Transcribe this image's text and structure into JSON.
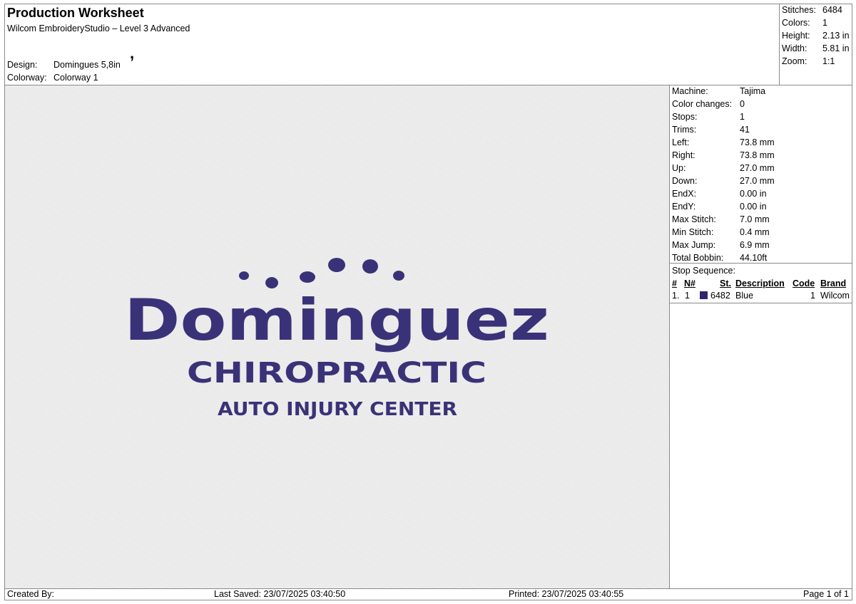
{
  "header": {
    "title": "Production Worksheet",
    "subtitle": "Wilcom EmbroideryStudio – Level 3 Advanced",
    "design_label": "Design:",
    "design_value": "Domingues 5,8in",
    "colorway_label": "Colorway:",
    "colorway_value": "Colorway 1",
    "mark": ","
  },
  "stats": [
    {
      "label": "Stitches:",
      "value": "6484"
    },
    {
      "label": "Colors:",
      "value": "1"
    },
    {
      "label": "Height:",
      "value": "2.13 in"
    },
    {
      "label": "Width:",
      "value": "5.81 in"
    },
    {
      "label": "Zoom:",
      "value": "1:1"
    }
  ],
  "machine_info": [
    {
      "label": "Machine:",
      "value": "Tajima"
    },
    {
      "label": "Color changes:",
      "value": "0"
    },
    {
      "label": "Stops:",
      "value": "1"
    },
    {
      "label": "Trims:",
      "value": "41"
    },
    {
      "label": "Left:",
      "value": "73.8 mm"
    },
    {
      "label": "Right:",
      "value": "73.8 mm"
    },
    {
      "label": "Up:",
      "value": "27.0 mm"
    },
    {
      "label": "Down:",
      "value": "27.0 mm"
    },
    {
      "label": "EndX:",
      "value": "0.00 in"
    },
    {
      "label": "EndY:",
      "value": "0.00 in"
    },
    {
      "label": "Max Stitch:",
      "value": "7.0 mm"
    },
    {
      "label": "Min Stitch:",
      "value": "0.4 mm"
    },
    {
      "label": "Max Jump:",
      "value": "6.9 mm"
    },
    {
      "label": "Total Bobbin:",
      "value": "44.10ft"
    }
  ],
  "stop_sequence": {
    "title": "Stop Sequence:",
    "headers": {
      "num": "#",
      "n": "N#",
      "st": "St.",
      "description": "Description",
      "code": "Code",
      "brand": "Brand"
    },
    "rows": [
      {
        "num": "1.",
        "n": "1",
        "color": "#2e2670",
        "st": "6482",
        "description": "Blue",
        "code": "1",
        "brand": "Wilcom"
      }
    ]
  },
  "design": {
    "line1": "Dominguez",
    "line2": "CHIROPRACTIC",
    "line3": "AUTO INJURY CENTER",
    "thread_color": "#3a3278"
  },
  "footer": {
    "created_by": "Created By:",
    "last_saved": "Last Saved: 23/07/2025 03:40:50",
    "printed": "Printed: 23/07/2025 03:40:55",
    "page": "Page 1 of 1"
  }
}
